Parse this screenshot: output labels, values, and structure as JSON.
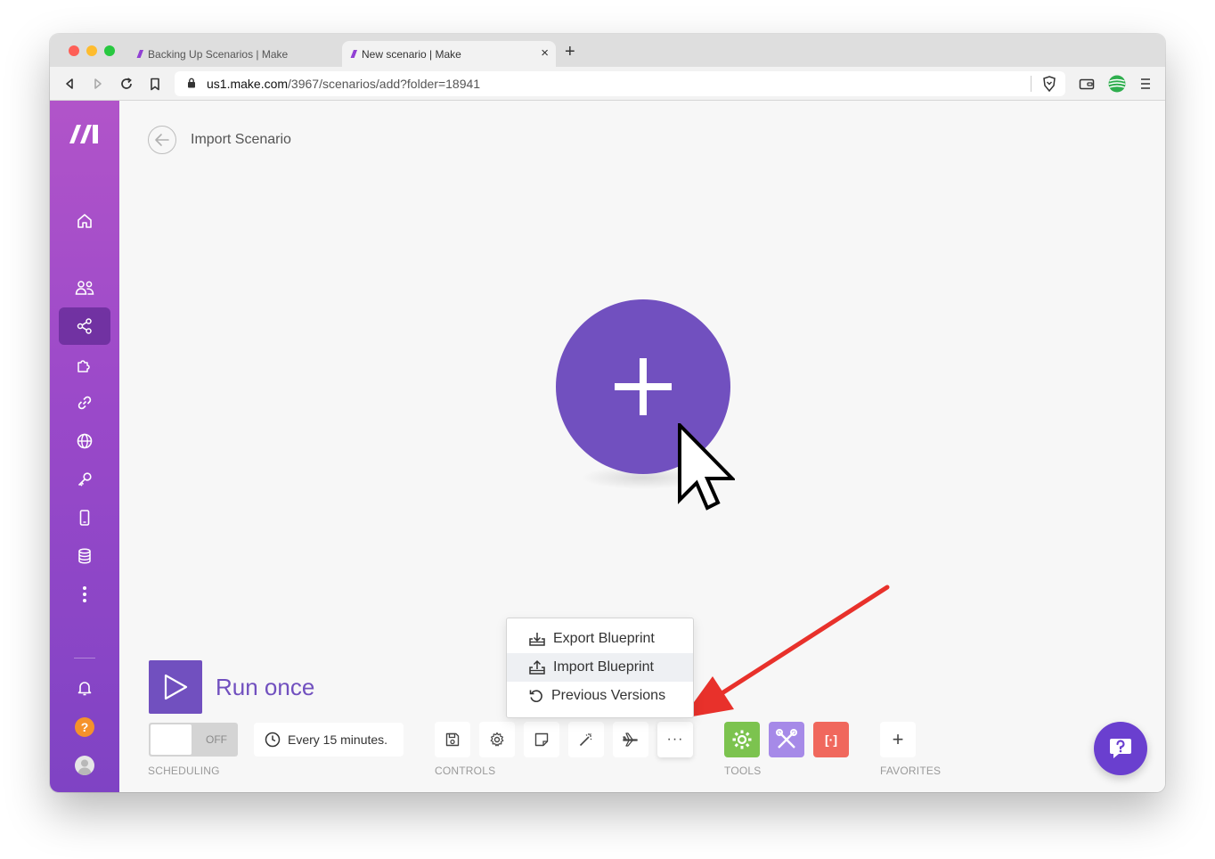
{
  "browser": {
    "tabs": [
      {
        "label": "Backing Up Scenarios | Make",
        "active": false
      },
      {
        "label": "New scenario | Make",
        "active": true
      }
    ],
    "tab_logo": "///",
    "new_tab_label": "+",
    "close_label": "×",
    "url_host": "us1.make.com",
    "url_path": "/3967/scenarios/add?folder=18941"
  },
  "header": {
    "title": "Import Scenario"
  },
  "sidebar": {
    "items": [
      "home-icon",
      "team-icon",
      "scenarios-icon",
      "templates-icon",
      "connections-icon",
      "webhooks-icon",
      "keys-icon",
      "devices-icon",
      "datastores-icon",
      "more-icon",
      "notifications-icon",
      "help-icon",
      "user-icon"
    ],
    "active": "scenarios-icon",
    "help_glyph": "?"
  },
  "run": {
    "label": "Run once"
  },
  "scheduling": {
    "toggle_label": "OFF",
    "interval": "Every 15 minutes.",
    "section_label": "SCHEDULING"
  },
  "controls": {
    "more_label": "···",
    "section_label": "CONTROLS"
  },
  "tools": {
    "section_label": "TOOLS",
    "red_tool_label": "[·]"
  },
  "favorites": {
    "section_label": "FAVORITES",
    "add_label": "+"
  },
  "menu": {
    "items": [
      {
        "label": "Export Blueprint",
        "icon": "export-icon"
      },
      {
        "label": "Import Blueprint",
        "icon": "import-icon",
        "highlighted": true
      },
      {
        "label": "Previous Versions",
        "icon": "history-icon"
      }
    ]
  },
  "colors": {
    "brand_purple": "#7150bf",
    "sidebar_top": "#b154c9",
    "sidebar_bottom": "#7f43c4",
    "annotation_red": "#e8312b",
    "tool_green": "#7cc34f",
    "tool_purple": "#a68ae8",
    "tool_red": "#f0685d"
  }
}
